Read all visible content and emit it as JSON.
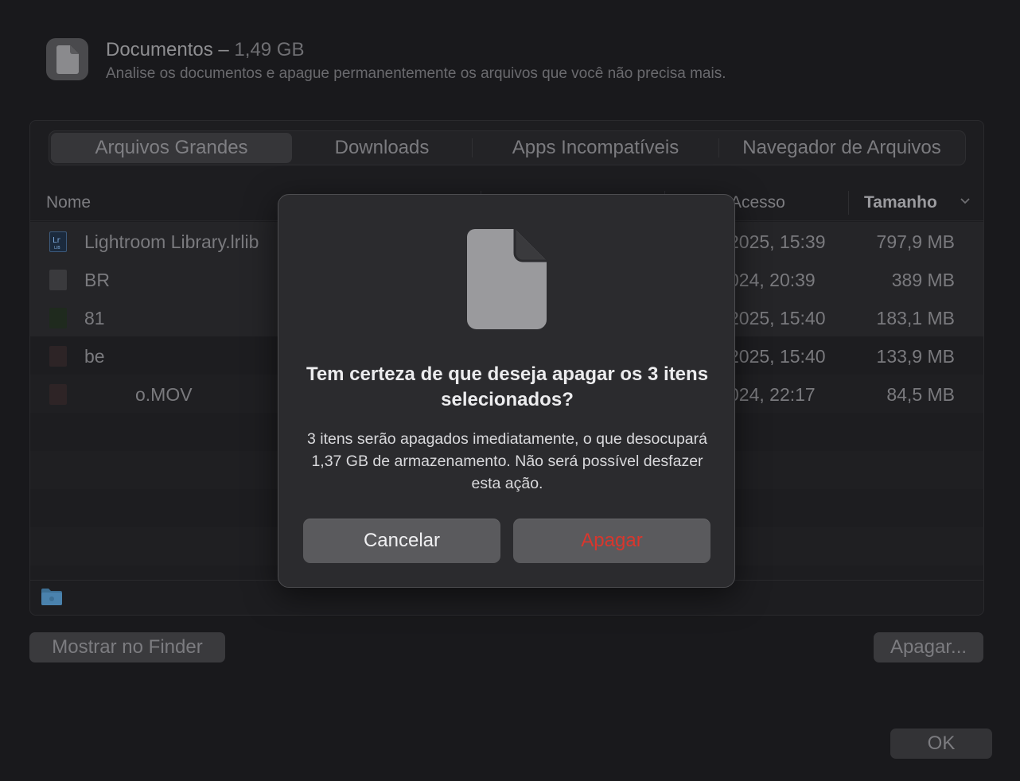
{
  "header": {
    "title": "Documentos",
    "title_separator": " – ",
    "total_size": "1,49 GB",
    "subtitle": "Analise os documentos e apague permanentemente os arquivos que você não precisa mais."
  },
  "tabs": [
    {
      "label": "Arquivos Grandes",
      "active": true
    },
    {
      "label": "Downloads",
      "active": false
    },
    {
      "label": "Apps Incompatíveis",
      "active": false
    },
    {
      "label": "Navegador de Arquivos",
      "active": false
    }
  ],
  "table": {
    "columns": {
      "name": "Nome",
      "kind": "",
      "access": "Acesso",
      "size": "Tamanho"
    },
    "rows": [
      {
        "name": "Lightroom Library.lrlib",
        "date": "2025, 15:39",
        "size": "797,9 MB"
      },
      {
        "name": "BR",
        "date": "024, 20:39",
        "size": "389 MB"
      },
      {
        "name": "81",
        "date": "2025, 15:40",
        "size": "183,1 MB"
      },
      {
        "name": "be",
        "date": "2025, 15:40",
        "size": "133,9 MB"
      },
      {
        "name": "o.MOV",
        "date": "024, 22:17",
        "size": "84,5 MB"
      }
    ]
  },
  "buttons": {
    "show_in_finder": "Mostrar no Finder",
    "delete": "Apagar...",
    "ok": "OK"
  },
  "dialog": {
    "title": "Tem certeza de que deseja apagar os 3 itens selecionados?",
    "message": "3 itens serão apagados imediatamente, o que desocupará 1,37 GB de armazenamento. Não será possível desfazer esta ação.",
    "cancel_label": "Cancelar",
    "confirm_label": "Apagar",
    "confirm_color": "#d9362d"
  }
}
